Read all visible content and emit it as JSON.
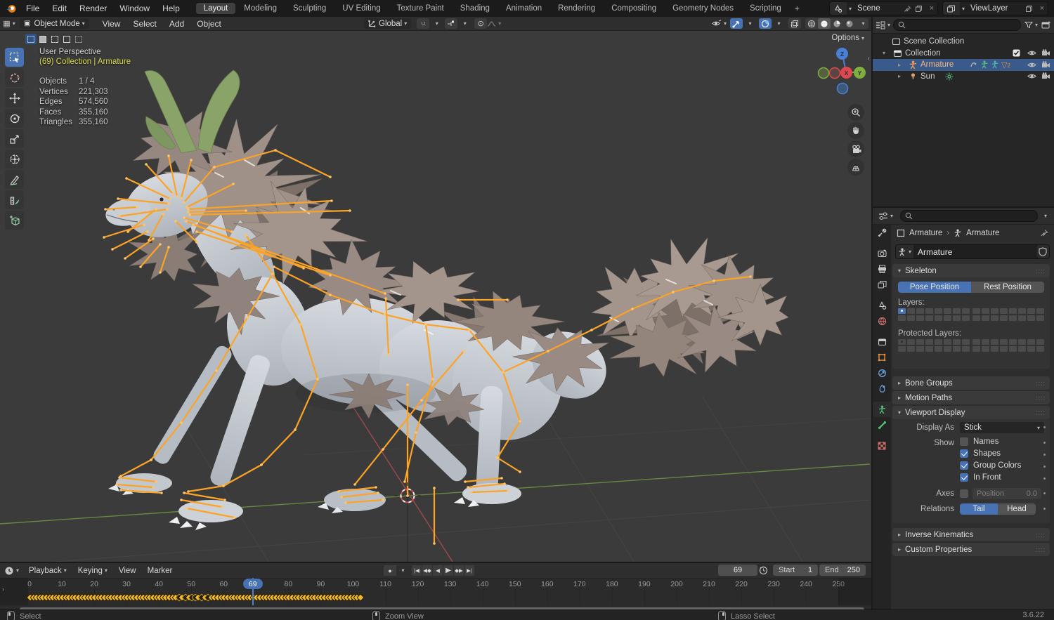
{
  "topbar": {
    "menus": [
      "File",
      "Edit",
      "Render",
      "Window",
      "Help"
    ],
    "workspaces": [
      "Layout",
      "Modeling",
      "Sculpting",
      "UV Editing",
      "Texture Paint",
      "Shading",
      "Animation",
      "Rendering",
      "Compositing",
      "Geometry Nodes",
      "Scripting"
    ],
    "active_workspace": "Layout",
    "add_workspace": "+",
    "scene": {
      "label": "Scene"
    },
    "view_layer": {
      "label": "ViewLayer"
    }
  },
  "viewport_header": {
    "mode": "Object Mode",
    "menus": [
      "View",
      "Select",
      "Add",
      "Object"
    ],
    "orientation": "Global",
    "options_label": "Options"
  },
  "viewport": {
    "perspective_label": "User Perspective",
    "context_label": "(69) Collection | Armature",
    "stats": [
      {
        "label": "Objects",
        "value": "1 / 4"
      },
      {
        "label": "Vertices",
        "value": "221,303"
      },
      {
        "label": "Edges",
        "value": "574,560"
      },
      {
        "label": "Faces",
        "value": "355,160"
      },
      {
        "label": "Triangles",
        "value": "355,160"
      }
    ],
    "gizmo_axes": {
      "x": "X",
      "y": "Y",
      "z": "Z"
    },
    "axis_colors": {
      "x": "#e0474f",
      "y": "#7fae3c",
      "z": "#4a7fd6"
    }
  },
  "outliner": {
    "rows": [
      {
        "label": "Scene Collection",
        "icon": "scene-collection",
        "arrow": "",
        "selected": false,
        "checkbox": false,
        "eye": false,
        "camera": false,
        "badges": []
      },
      {
        "label": "Collection",
        "icon": "collection",
        "arrow": "open",
        "selected": false,
        "checkbox": true,
        "eye": true,
        "camera": true,
        "badges": []
      },
      {
        "label": "Armature",
        "icon": "armature",
        "arrow": "closed",
        "selected": true,
        "checkbox": false,
        "eye": true,
        "camera": true,
        "badges": [
          "action",
          "pose",
          "armature-data",
          "modifier-2"
        ]
      },
      {
        "label": "Sun",
        "icon": "light",
        "arrow": "closed",
        "selected": false,
        "checkbox": false,
        "eye": true,
        "camera": true,
        "badges": [
          "sun"
        ]
      }
    ],
    "modifier_badge_count": "2"
  },
  "properties": {
    "tabs": [
      {
        "name": "tool",
        "active": false
      },
      {
        "name": "render",
        "active": false
      },
      {
        "name": "output",
        "active": false
      },
      {
        "name": "view-layer",
        "active": false
      },
      {
        "name": "scene",
        "active": false
      },
      {
        "name": "world",
        "active": false
      },
      {
        "name": "collection",
        "active": false
      },
      {
        "name": "object",
        "active": false
      },
      {
        "name": "constraints",
        "active": false
      },
      {
        "name": "physics",
        "active": false
      },
      {
        "name": "object-data",
        "active": true
      },
      {
        "name": "bone",
        "active": false
      },
      {
        "name": "texture",
        "active": false
      }
    ],
    "breadcrumb": {
      "object": "Armature",
      "data": "Armature"
    },
    "name_field": "Armature",
    "skeleton": {
      "title": "Skeleton",
      "pose_position": "Pose Position",
      "rest_position": "Rest Position",
      "layers_label": "Layers:",
      "protected_label": "Protected Layers:"
    },
    "panels_top": [
      "Bone Groups",
      "Motion Paths"
    ],
    "viewport_display": {
      "title": "Viewport Display",
      "display_as_label": "Display As",
      "display_as_value": "Stick",
      "show_label": "Show",
      "checkboxes": [
        {
          "label": "Names",
          "checked": false
        },
        {
          "label": "Shapes",
          "checked": true
        },
        {
          "label": "Group Colors",
          "checked": true
        },
        {
          "label": "In Front",
          "checked": true
        }
      ],
      "axes_label": "Axes",
      "position_label": "Position",
      "position_value": "0.0",
      "relations_label": "Relations",
      "tail": "Tail",
      "head": "Head"
    },
    "panels_bottom": [
      "Inverse Kinematics",
      "Custom Properties"
    ]
  },
  "timeline": {
    "menus": [
      "Playback",
      "Keying",
      "View",
      "Marker"
    ],
    "current_frame": "69",
    "start_label": "Start",
    "start_value": "1",
    "end_label": "End",
    "end_value": "250",
    "ruler": {
      "min": 0,
      "max": 250,
      "step": 10
    },
    "keyframes": {
      "from": 0,
      "to": 102,
      "dark": [
        46,
        48,
        50,
        51,
        53,
        55
      ]
    }
  },
  "statusbar": {
    "hints": [
      {
        "icon": "mouse-left",
        "label": "Select"
      },
      {
        "icon": "mouse-middle",
        "label": "Zoom View"
      },
      {
        "icon": "mouse-right",
        "label": "Lasso Select"
      }
    ],
    "version": "3.6.22"
  },
  "icons": {
    "chevron-down": "▾",
    "disclosure-open": "▾",
    "disclosure-closed": "▸",
    "breadcrumb-sep": "›",
    "modifier-triangle": "▽",
    "close": "×",
    "panel-arrow": "›",
    "record": "●",
    "prop-edit": "⊙",
    "falloff": "~",
    "magnet": "∩",
    "editor-grid": "▦",
    "mode-square": "▣",
    "jump-first": "|◀",
    "key-prev": "◀◆",
    "play-back": "◀",
    "play": "▶",
    "key-next": "◆▶",
    "jump-last": "▶|"
  }
}
